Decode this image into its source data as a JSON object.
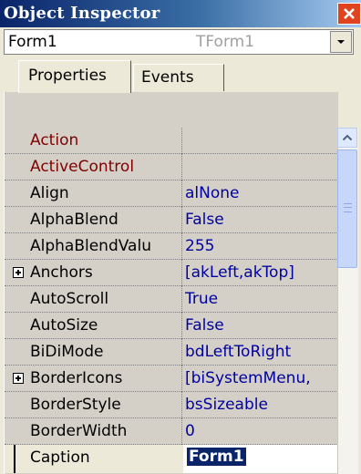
{
  "window": {
    "title": "Object Inspector"
  },
  "selector": {
    "object_name": "Form1",
    "object_type": "TForm1"
  },
  "tabs": [
    {
      "label": "Properties",
      "active": true
    },
    {
      "label": "Events",
      "active": false
    }
  ],
  "properties": [
    {
      "name": "Action",
      "value": "",
      "expandable": false,
      "name_color": "red"
    },
    {
      "name": "ActiveControl",
      "value": "",
      "expandable": false,
      "name_color": "red"
    },
    {
      "name": "Align",
      "value": "alNone",
      "expandable": false,
      "name_color": "black"
    },
    {
      "name": "AlphaBlend",
      "value": "False",
      "expandable": false,
      "name_color": "black"
    },
    {
      "name": "AlphaBlendValu",
      "value": "255",
      "expandable": false,
      "name_color": "black"
    },
    {
      "name": "Anchors",
      "value": "[akLeft,akTop]",
      "expandable": true,
      "name_color": "black"
    },
    {
      "name": "AutoScroll",
      "value": "True",
      "expandable": false,
      "name_color": "black"
    },
    {
      "name": "AutoSize",
      "value": "False",
      "expandable": false,
      "name_color": "black"
    },
    {
      "name": "BiDiMode",
      "value": "bdLeftToRight",
      "expandable": false,
      "name_color": "black"
    },
    {
      "name": "BorderIcons",
      "value": "[biSystemMenu,",
      "expandable": true,
      "name_color": "black"
    },
    {
      "name": "BorderStyle",
      "value": "bsSizeable",
      "expandable": false,
      "name_color": "black"
    },
    {
      "name": "BorderWidth",
      "value": "0",
      "expandable": false,
      "name_color": "black"
    },
    {
      "name": "Caption",
      "value": "Form1",
      "expandable": false,
      "name_color": "black",
      "selected": true
    }
  ],
  "colors": {
    "title_gradient_start": "#0a246a",
    "value_text": "#0000a0",
    "event_link_text": "#800000",
    "selection": "#0a246a"
  },
  "icons": {
    "close": "close-icon",
    "dropdown": "chevron-down-icon",
    "expand": "plus-box-icon",
    "scroll_up": "chevron-up-icon"
  }
}
